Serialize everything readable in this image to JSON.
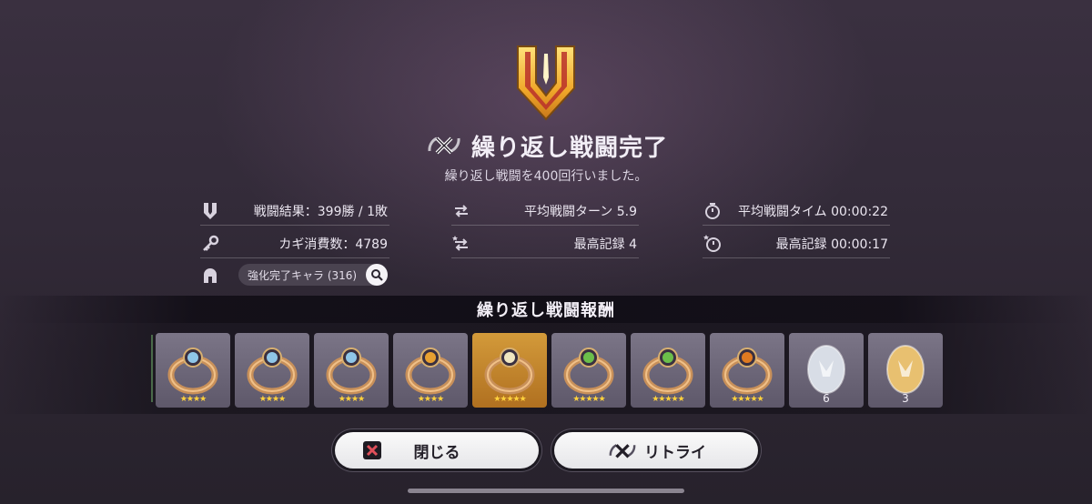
{
  "header": {
    "title": "繰り返し戦闘完了",
    "subtitle": "繰り返し戦闘を400回行いました。"
  },
  "stats": {
    "result": "戦闘結果：399勝 / 1敗",
    "keys": "カギ消費数：4789",
    "avg_turn": "平均戦闘ターン 5.9",
    "best_turn": "最高記録 4",
    "avg_time": "平均戦闘タイム 00:00:22",
    "best_time": "最高記録 00:00:17",
    "enhanced_label": "強化完了キャラ (316)"
  },
  "rewards": {
    "title": "繰り返し戦闘報酬",
    "items": [
      {
        "icon": "ring-icon",
        "gem": "#8fc6e8",
        "stars": "★★★★",
        "count": ""
      },
      {
        "icon": "ring-icon",
        "gem": "#8fc6e8",
        "stars": "★★★★",
        "count": ""
      },
      {
        "icon": "ring-icon",
        "gem": "#8fc6e8",
        "stars": "★★★★",
        "count": ""
      },
      {
        "icon": "ring-icon",
        "gem": "#e8a030",
        "stars": "★★★★",
        "count": ""
      },
      {
        "icon": "ring-icon",
        "gem": "#f0e6c0",
        "stars": "★★★★★",
        "count": ""
      },
      {
        "icon": "ring-icon",
        "gem": "#6bbf4a",
        "stars": "★★★★★",
        "count": ""
      },
      {
        "icon": "ring-icon",
        "gem": "#6bbf4a",
        "stars": "★★★★★",
        "count": ""
      },
      {
        "icon": "ring-icon",
        "gem": "#e07a20",
        "stars": "★★★★★",
        "count": ""
      },
      {
        "icon": "silver-egg-icon",
        "gem": "#d8dde6",
        "stars": "",
        "count": "6"
      },
      {
        "icon": "gold-egg-icon",
        "gem": "#e8c070",
        "stars": "",
        "count": "3"
      }
    ]
  },
  "buttons": {
    "close": "閉じる",
    "retry": "リトライ"
  },
  "colors": {
    "accent_gold": "#f0b43c",
    "close_red": "#e0505a"
  }
}
